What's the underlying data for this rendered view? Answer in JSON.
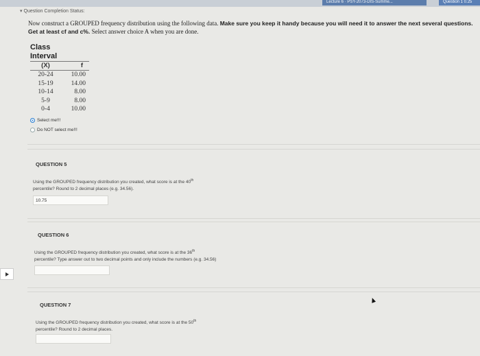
{
  "topbar": {
    "tab1": "Lecture 6 · PSY-2073-DIS-Summe...",
    "tab2": "Question 1 0.25"
  },
  "status": {
    "label": "Question Completion Status:"
  },
  "intro": {
    "part1": "Now construct a GROUPED frequency distribution using the following data. ",
    "part2": "Make sure you keep it handy because you will need it to answer the next several questions. Get at least cf and c%. ",
    "part3": "Select answer choice A when you are done."
  },
  "table": {
    "header_line1": "Class",
    "header_line2": "Interval",
    "col_x": "(X)",
    "col_f": "f",
    "rows": [
      {
        "x": "20-24",
        "f": "10.00"
      },
      {
        "x": "15-19",
        "f": "14.00"
      },
      {
        "x": "10-14",
        "f": "8.00"
      },
      {
        "x": "5-9",
        "f": "8.00"
      },
      {
        "x": "0-4",
        "f": "10.00"
      }
    ]
  },
  "choices": [
    {
      "label": "Select me!!!",
      "selected": true
    },
    {
      "label": "Do NOT select me!!!",
      "selected": false
    }
  ],
  "q5": {
    "title": "QUESTION 5",
    "text_a": "Using the GROUPED frequency distribution you created, what score is at the 40",
    "sup": "th",
    "text_b": "percentile? Round to 2 decimal places (e.g. 34.56).",
    "answer": "10.75"
  },
  "q6": {
    "title": "QUESTION 6",
    "text_a": "Using the GROUPED frequency distribution you created, what score is at the 36",
    "sup": "th",
    "text_b": "percentile?  Type answer out to two decimal points and only include the numbers (e.g. 34.56)",
    "answer": ""
  },
  "q7": {
    "title": "QUESTION 7",
    "text_a": "Using the GROUPED frequency distribution you created, what score is at the 50",
    "sup": "th",
    "text_b": "percentile? Round to 2 decimal places.",
    "answer": ""
  }
}
